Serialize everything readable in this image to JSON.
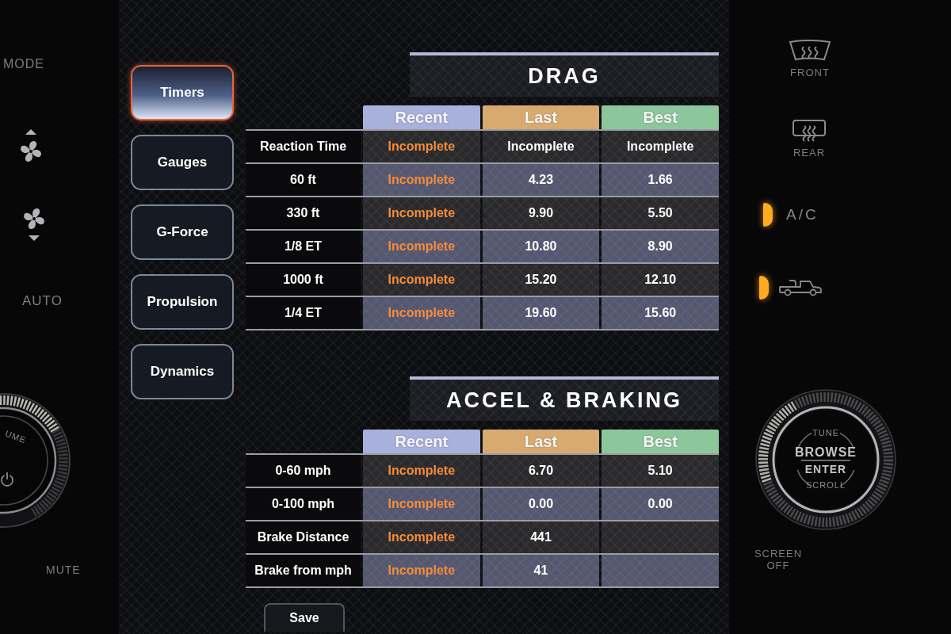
{
  "left_controls": {
    "mode_label": "MODE",
    "auto_label": "AUTO",
    "volume_knob_label": "UME",
    "mute_label": "MUTE"
  },
  "nav": [
    {
      "label": "Timers",
      "selected": true
    },
    {
      "label": "Gauges",
      "selected": false
    },
    {
      "label": "G-Force",
      "selected": false
    },
    {
      "label": "Propulsion",
      "selected": false
    },
    {
      "label": "Dynamics",
      "selected": false
    }
  ],
  "sections": [
    {
      "title": "DRAG",
      "columns": [
        {
          "label": "Recent",
          "kind": "recent",
          "color": "#a8b0dc"
        },
        {
          "label": "Last",
          "kind": "stored",
          "color": "#d8aa70"
        },
        {
          "label": "Best",
          "kind": "stored",
          "color": "#8cc79c"
        }
      ],
      "rows": [
        {
          "label": "Reaction Time",
          "values": [
            "Incomplete",
            "Incomplete",
            "Incomplete"
          ]
        },
        {
          "label": "60 ft",
          "values": [
            "Incomplete",
            "4.23",
            "1.66"
          ]
        },
        {
          "label": "330 ft",
          "values": [
            "Incomplete",
            "9.90",
            "5.50"
          ]
        },
        {
          "label": "1/8 ET",
          "values": [
            "Incomplete",
            "10.80",
            "8.90"
          ]
        },
        {
          "label": "1000 ft",
          "values": [
            "Incomplete",
            "15.20",
            "12.10"
          ]
        },
        {
          "label": "1/4 ET",
          "values": [
            "Incomplete",
            "19.60",
            "15.60"
          ]
        }
      ]
    },
    {
      "title": "ACCEL & BRAKING",
      "columns": [
        {
          "label": "Recent",
          "kind": "recent",
          "color": "#a8b0dc"
        },
        {
          "label": "Last",
          "kind": "stored",
          "color": "#d8aa70"
        },
        {
          "label": "Best",
          "kind": "stored",
          "color": "#8cc79c"
        }
      ],
      "rows": [
        {
          "label": "0-60 mph",
          "values": [
            "Incomplete",
            "6.70",
            "5.10"
          ]
        },
        {
          "label": "0-100 mph",
          "values": [
            "Incomplete",
            "0.00",
            "0.00"
          ]
        },
        {
          "label": "Brake Distance",
          "values": [
            "Incomplete",
            "441"
          ]
        },
        {
          "label": "Brake from mph",
          "values": [
            "Incomplete",
            "41"
          ]
        }
      ]
    }
  ],
  "save_button": "Save",
  "right_controls": {
    "front_defrost_label": "FRONT",
    "rear_defrost_label": "REAR",
    "ac": {
      "label": "A/C",
      "on": true
    },
    "truck_indicator": {
      "on": true
    },
    "knob": {
      "top_label": "TUNE",
      "main_label": "BROWSE",
      "sub_label": "ENTER",
      "bottom_label": "SCROLL"
    },
    "screen_off_label": "SCREEN OFF"
  }
}
